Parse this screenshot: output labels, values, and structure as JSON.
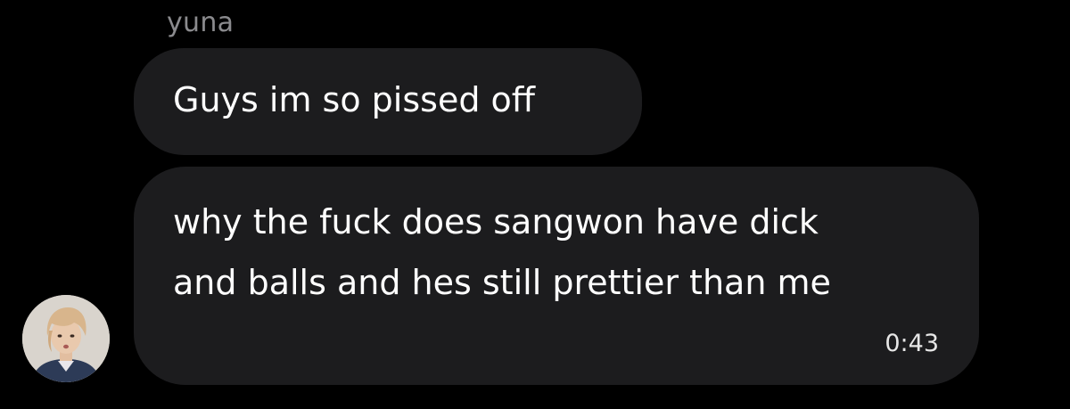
{
  "conversation": {
    "sender_name": "yuna",
    "messages": [
      {
        "text": "Guys im so pissed off"
      },
      {
        "text": "why the fuck does sangwon have dick\nand balls and hes still prettier than me",
        "time": "0:43"
      }
    ]
  },
  "avatar": {
    "icon": "profile-photo",
    "description_colors": {
      "hair": "#d8b58c",
      "skin": "#e9c9ad",
      "shirt": "#2d3b57",
      "background": "#d9d4cd"
    }
  },
  "colors": {
    "background": "#000000",
    "bubble": "#1c1c1e",
    "text": "#ffffff",
    "name": "#8b8b8e",
    "timestamp": "#e6e6e6"
  }
}
